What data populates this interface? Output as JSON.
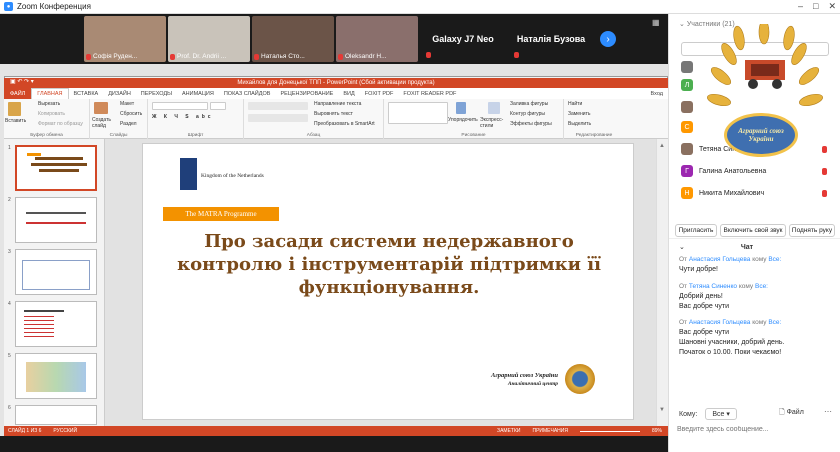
{
  "zoom": {
    "title": "Zoom Конференция"
  },
  "video_tiles": [
    {
      "name": "Софія Руден...",
      "bg": "#a98a74"
    },
    {
      "name": "Prof. Dr. Andrii ...",
      "bg": "#c9c3ba"
    },
    {
      "name": "Наталья Сто...",
      "bg": "#6b5448"
    },
    {
      "name": "Oleksandr H...",
      "bg": "#8a6f6c"
    }
  ],
  "named_tiles": [
    "Galaxy J7 Neo",
    "Наталія Бузова"
  ],
  "ppt": {
    "title": "Михайлов для Донецької ТПП - PowerPoint (Сбой активации продукта)",
    "login": "Вход",
    "tabs": [
      "ФАЙЛ",
      "ГЛАВНАЯ",
      "ВСТАВКА",
      "ДИЗАЙН",
      "ПЕРЕХОДЫ",
      "АНИМАЦИЯ",
      "ПОКАЗ СЛАЙДОВ",
      "РЕЦЕНЗИРОВАНИЕ",
      "ВИД",
      "FOXIT PDF",
      "FOXIT READER PDF"
    ],
    "ribbon": {
      "paste": "Вставить",
      "cut": "Вырезать",
      "copy": "Копировать",
      "format": "Формат по образцу",
      "clipboard": "Буфер обмена",
      "new_slide": "Создать слайд",
      "layout": "Макет",
      "reset": "Сбросить",
      "section": "Раздел",
      "slides": "Слайды",
      "font": "Шрифт",
      "text_dir": "Направление текста",
      "align_text": "Выровнять текст",
      "smartart": "Преобразовать в SmartArt",
      "paragraph": "Абзац",
      "arrange": "Упорядочить",
      "quick_styles": "Экспресс-стили",
      "fill": "Заливка фигуры",
      "outline": "Контур фигуры",
      "effects": "Эффекты фигуры",
      "drawing": "Рисование",
      "find": "Найти",
      "replace": "Заменить",
      "select": "Выделить",
      "editing": "Редактирование"
    },
    "thumb_numbers": [
      "1",
      "2",
      "3",
      "4",
      "5",
      "6"
    ],
    "status": {
      "slide": "СЛАЙД 1 ИЗ 6",
      "lang": "РУССКИЙ",
      "notes": "ЗАМЕТКИ",
      "comments": "ПРИМЕЧАНИЯ",
      "zoom": "89%"
    }
  },
  "slide": {
    "nl_text": "Kingdom of the Netherlands",
    "matra": "The MATRA Programme",
    "title": "Про засади системи недержавного контролю і інструментарій підтримки її функціонування.",
    "org_name": "Аграрний союз України",
    "org_sub": "Аналітичний центр"
  },
  "participants": {
    "header": "Участники (21)",
    "rows": [
      {
        "initial": "Л",
        "color": "#4caf50",
        "name": ""
      },
      {
        "initial": "С",
        "color": "#ff9800",
        "name": ""
      },
      {
        "initial": "",
        "color": "#8a7060",
        "name": "Тетяна Синенко"
      },
      {
        "initial": "Г",
        "color": "#9c27b0",
        "name": "Галина Анатольевна"
      },
      {
        "initial": "Н",
        "color": "#ff9800",
        "name": "Никита Михайлович"
      }
    ],
    "buttons": {
      "invite": "Пригласить",
      "unmute": "Включить свой звук",
      "raise": "Поднять руку"
    }
  },
  "logo_text": "Аграрний союз України",
  "chat": {
    "header": "Чат",
    "from_label": "От",
    "to_label": "кому",
    "messages": [
      {
        "sender": "Анастасия Гольцева",
        "to": "Все:",
        "lines": [
          "Чути добре!"
        ]
      },
      {
        "sender": "Тетяна Синенко",
        "to": "Все:",
        "lines": [
          "Добрий день!",
          "Вас добре чути"
        ]
      },
      {
        "sender": "Анастасия Гольцева",
        "to": "Все:",
        "lines": [
          "Вас добре чути",
          "Шановні учасники, добрий день.",
          "Початок о 10.00. Поки чекаємо!"
        ]
      }
    ],
    "to_field": "Кому:",
    "to_value": "Все",
    "file": "Файл",
    "placeholder": "Введите здесь сообщение..."
  }
}
